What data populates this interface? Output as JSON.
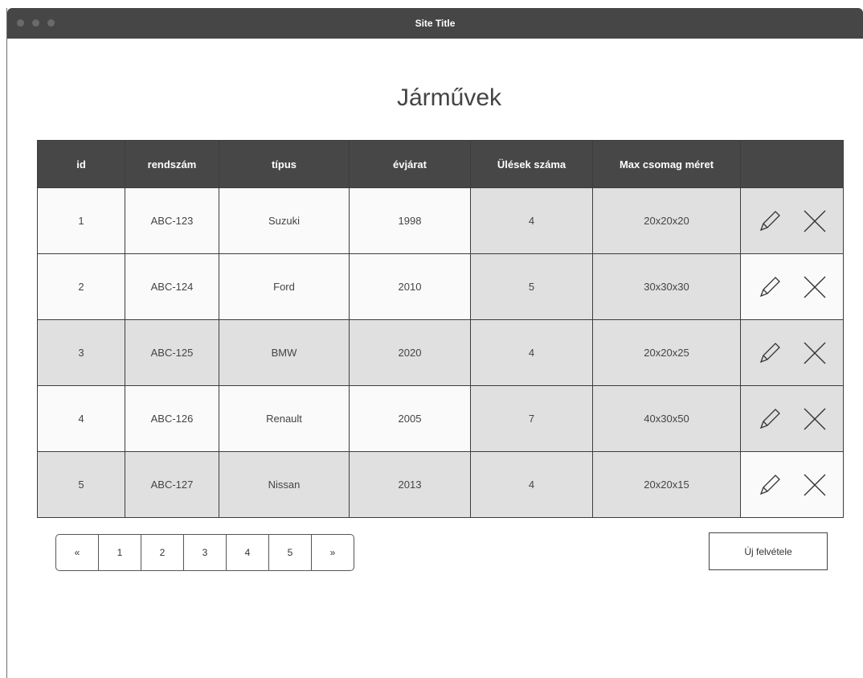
{
  "window": {
    "title": "Site Title"
  },
  "page": {
    "title": "Járművek"
  },
  "table": {
    "headers": [
      "id",
      "rendszám",
      "típus",
      "évjárat",
      "Ülések száma",
      "Max csomag méret",
      ""
    ],
    "rows": [
      {
        "id": "1",
        "plate": "ABC-123",
        "type": "Suzuki",
        "year": "1998",
        "seats": "4",
        "max_package": "20x20x20"
      },
      {
        "id": "2",
        "plate": "ABC-124",
        "type": "Ford",
        "year": "2010",
        "seats": "5",
        "max_package": "30x30x30"
      },
      {
        "id": "3",
        "plate": "ABC-125",
        "type": "BMW",
        "year": "2020",
        "seats": "4",
        "max_package": "20x20x25"
      },
      {
        "id": "4",
        "plate": "ABC-126",
        "type": "Renault",
        "year": "2005",
        "seats": "7",
        "max_package": "40x30x50"
      },
      {
        "id": "5",
        "plate": "ABC-127",
        "type": "Nissan",
        "year": "2013",
        "seats": "4",
        "max_package": "20x20x15"
      }
    ],
    "row_actions": [
      "pencil-icon",
      "close-icon"
    ]
  },
  "pagination": {
    "items": [
      "«",
      "1",
      "2",
      "3",
      "4",
      "5",
      "»"
    ]
  },
  "new_button": {
    "label": "Új felvétele"
  },
  "colors": {
    "header_bg": "#474747",
    "shaded_cell": "#e0e0e0",
    "titlebar": "#464646"
  }
}
